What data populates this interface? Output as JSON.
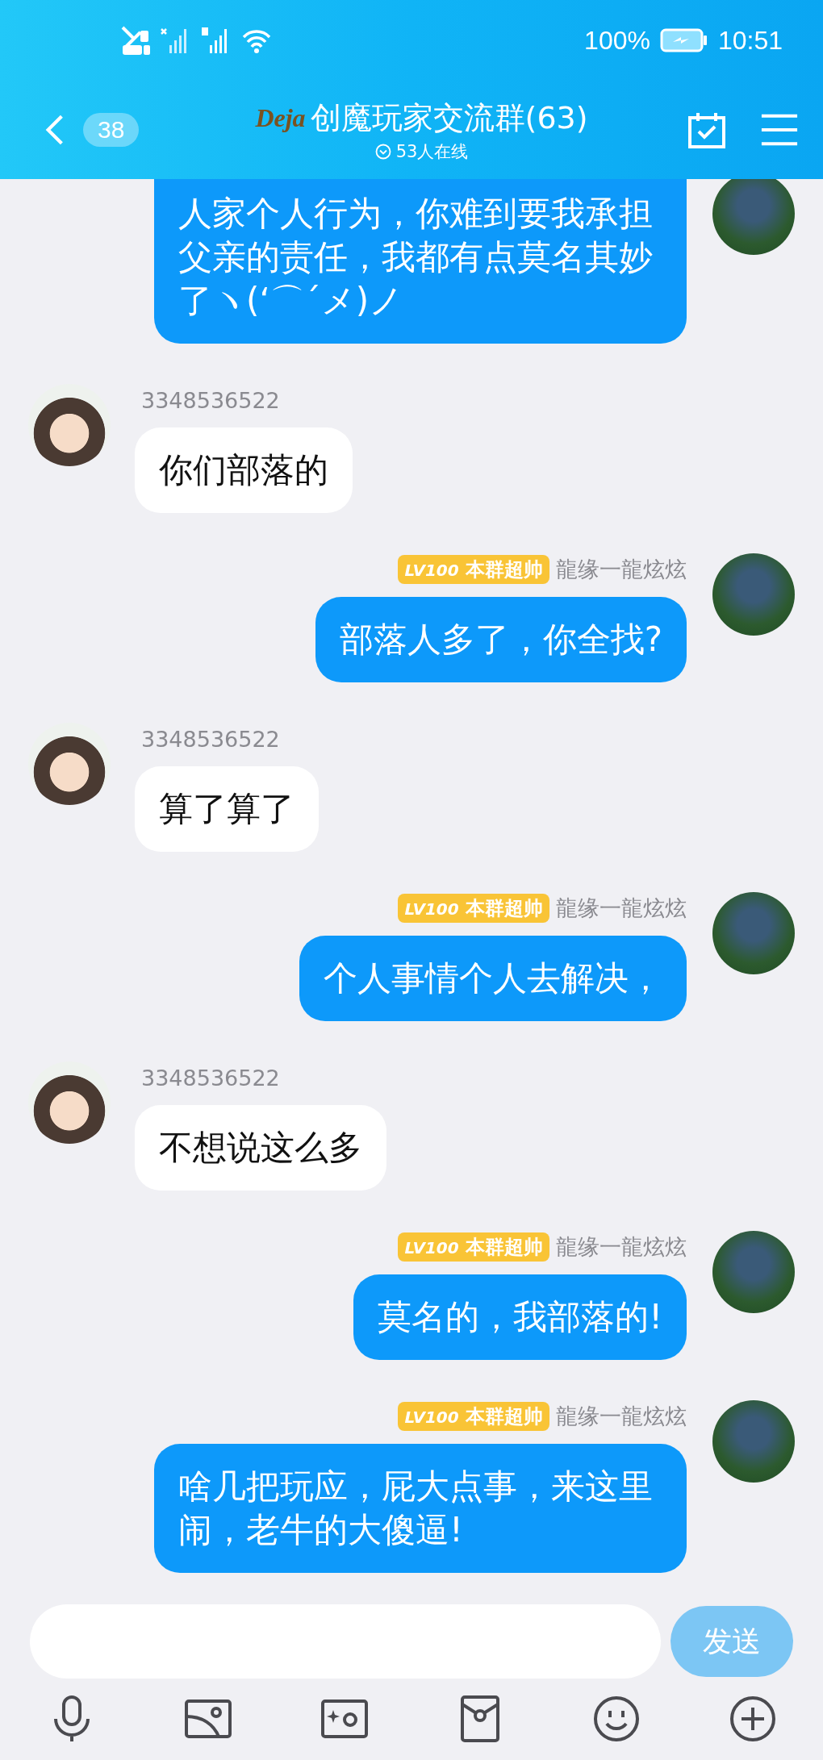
{
  "status_bar": {
    "battery_percent": "100%",
    "time": "10:51"
  },
  "header": {
    "back_count": "38",
    "logo_text": "Deja",
    "title": "创魔玩家交流群(63)",
    "online": "53人在线"
  },
  "messages": [
    {
      "kind": "outgoing",
      "text": "人家个人行为，你难到要我承担父亲的责任，我都有点莫名其妙了ヽ(‘⌒´メ)ノ"
    },
    {
      "kind": "incoming",
      "sender": "3348536522",
      "text": "你们部落的"
    },
    {
      "kind": "outgoing",
      "badge_level": "LV100",
      "badge_title": "本群超帅",
      "sender": "龍缘一龍炫炫",
      "text": "部落人多了，你全找?"
    },
    {
      "kind": "incoming",
      "sender": "3348536522",
      "text": "算了算了"
    },
    {
      "kind": "outgoing",
      "badge_level": "LV100",
      "badge_title": "本群超帅",
      "sender": "龍缘一龍炫炫",
      "text": "个人事情个人去解决，"
    },
    {
      "kind": "incoming",
      "sender": "3348536522",
      "text": "不想说这么多"
    },
    {
      "kind": "outgoing",
      "badge_level": "LV100",
      "badge_title": "本群超帅",
      "sender": "龍缘一龍炫炫",
      "text": "莫名的，我部落的!"
    },
    {
      "kind": "outgoing",
      "badge_level": "LV100",
      "badge_title": "本群超帅",
      "sender": "龍缘一龍炫炫",
      "text": "啥几把玩应，屁大点事，来这里闹，老牛的大傻逼!"
    }
  ],
  "composer": {
    "send_label": "发送"
  }
}
